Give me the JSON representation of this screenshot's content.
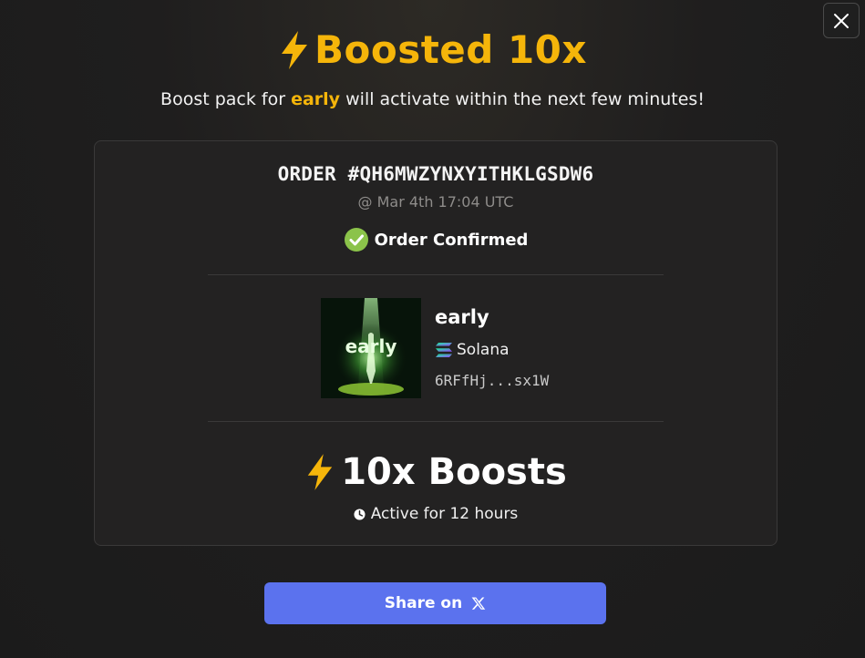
{
  "dialog": {
    "title": "Boosted 10x",
    "subtitle_prefix": "Boost pack for",
    "subtitle_token": "early",
    "subtitle_suffix": "will activate within the next few minutes!",
    "close_icon": "close-icon"
  },
  "order": {
    "id_label": "ORDER #QH6MWZYNXYITHKLGSDW6",
    "date": "@ Mar 4th 17:04 UTC",
    "status": "Order Confirmed",
    "status_color": "#8bc34a"
  },
  "token": {
    "name": "early",
    "image_text": "early",
    "chain": "Solana",
    "address": "6RFfHj...sx1W"
  },
  "boost": {
    "label": "10x Boosts",
    "duration": "Active for 12 hours"
  },
  "share": {
    "label": "Share on",
    "icon": "x-logo-icon"
  },
  "colors": {
    "accent": "#f5b50a",
    "button": "#5b72ee",
    "card_bg": "#232222"
  }
}
